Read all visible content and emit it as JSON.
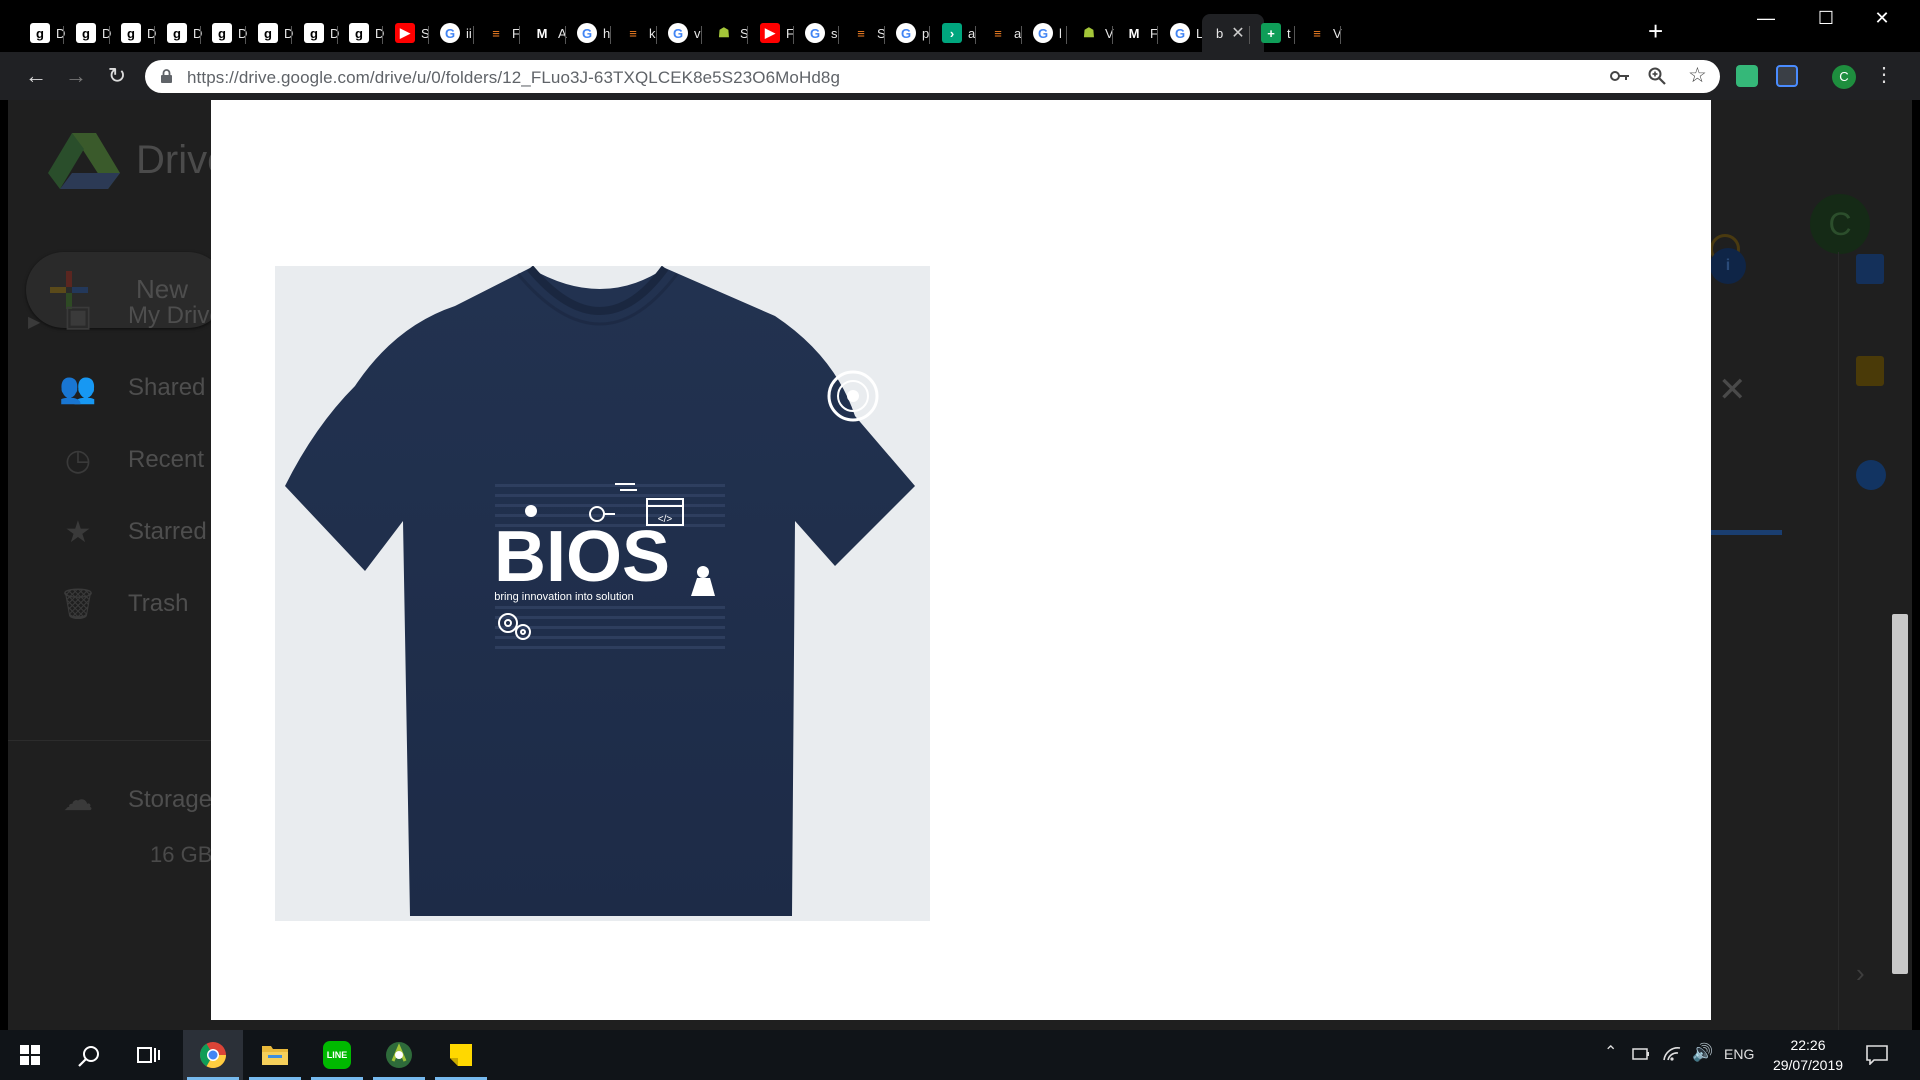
{
  "browser": {
    "tabs": [
      {
        "icon": "g-site-icon",
        "label": "D"
      },
      {
        "icon": "g-site-icon",
        "label": "D"
      },
      {
        "icon": "g-site-icon",
        "label": "D"
      },
      {
        "icon": "g-site-icon",
        "label": "D"
      },
      {
        "icon": "g-site-icon",
        "label": "D"
      },
      {
        "icon": "g-site-icon",
        "label": "D"
      },
      {
        "icon": "g-site-icon",
        "label": "D"
      },
      {
        "icon": "g-site-icon",
        "label": "D"
      },
      {
        "icon": "youtube-icon",
        "label": "S"
      },
      {
        "icon": "google-icon",
        "label": "ii"
      },
      {
        "icon": "stackoverflow-icon",
        "label": "F"
      },
      {
        "icon": "medium-icon",
        "label": "A"
      },
      {
        "icon": "google-icon",
        "label": "h"
      },
      {
        "icon": "stackoverflow-icon",
        "label": "k"
      },
      {
        "icon": "google-icon",
        "label": "v"
      },
      {
        "icon": "android-icon",
        "label": "S"
      },
      {
        "icon": "youtube-icon",
        "label": "F"
      },
      {
        "icon": "google-icon",
        "label": "s"
      },
      {
        "icon": "stackoverflow-icon",
        "label": "S"
      },
      {
        "icon": "google-icon",
        "label": "p"
      },
      {
        "icon": "terminal-icon",
        "label": "a"
      },
      {
        "icon": "stackoverflow-icon",
        "label": "a"
      },
      {
        "icon": "google-icon",
        "label": "l"
      },
      {
        "icon": "android-icon",
        "label": "V"
      },
      {
        "icon": "medium-icon",
        "label": "F"
      },
      {
        "icon": "google-icon",
        "label": "L"
      },
      {
        "icon": "none",
        "label": "b",
        "active": true
      },
      {
        "icon": "sheets-icon",
        "label": "t"
      },
      {
        "icon": "stackoverflow-icon",
        "label": "V"
      }
    ],
    "new_tab": "+",
    "window_controls": {
      "minimize": "—",
      "maximize": "☐",
      "close": "✕"
    },
    "url": "https://drive.google.com/drive/u/0/folders/12_FLuo3J-63TXQLCEK8e5S23O6MoHd8g",
    "profile_initial": "C"
  },
  "drive": {
    "app_name": "Drive",
    "new_button": "New",
    "sidebar": [
      {
        "icon": "my-drive-icon",
        "label": "My Drive"
      },
      {
        "icon": "shared-icon",
        "label": "Shared with me"
      },
      {
        "icon": "clock-icon",
        "label": "Recent"
      },
      {
        "icon": "star-icon",
        "label": "Starred"
      },
      {
        "icon": "trash-icon",
        "label": "Trash"
      }
    ],
    "storage_label": "Storage",
    "storage_value": "16 GB",
    "avatar_initial": "C"
  },
  "preview": {
    "brand": "BIOS",
    "tagline": "bring innovation into solution",
    "shirt_color": "#223250",
    "code_glyph": "</>"
  },
  "taskbar": {
    "apps": [
      {
        "icon": "chrome-icon",
        "running": true,
        "active": true
      },
      {
        "icon": "file-explorer-icon",
        "running": true
      },
      {
        "icon": "line-app-icon",
        "running": true
      },
      {
        "icon": "android-studio-icon",
        "running": true
      },
      {
        "icon": "sticky-notes-icon",
        "running": true
      }
    ],
    "language": "ENG",
    "time": "22:26",
    "date": "29/07/2019"
  }
}
